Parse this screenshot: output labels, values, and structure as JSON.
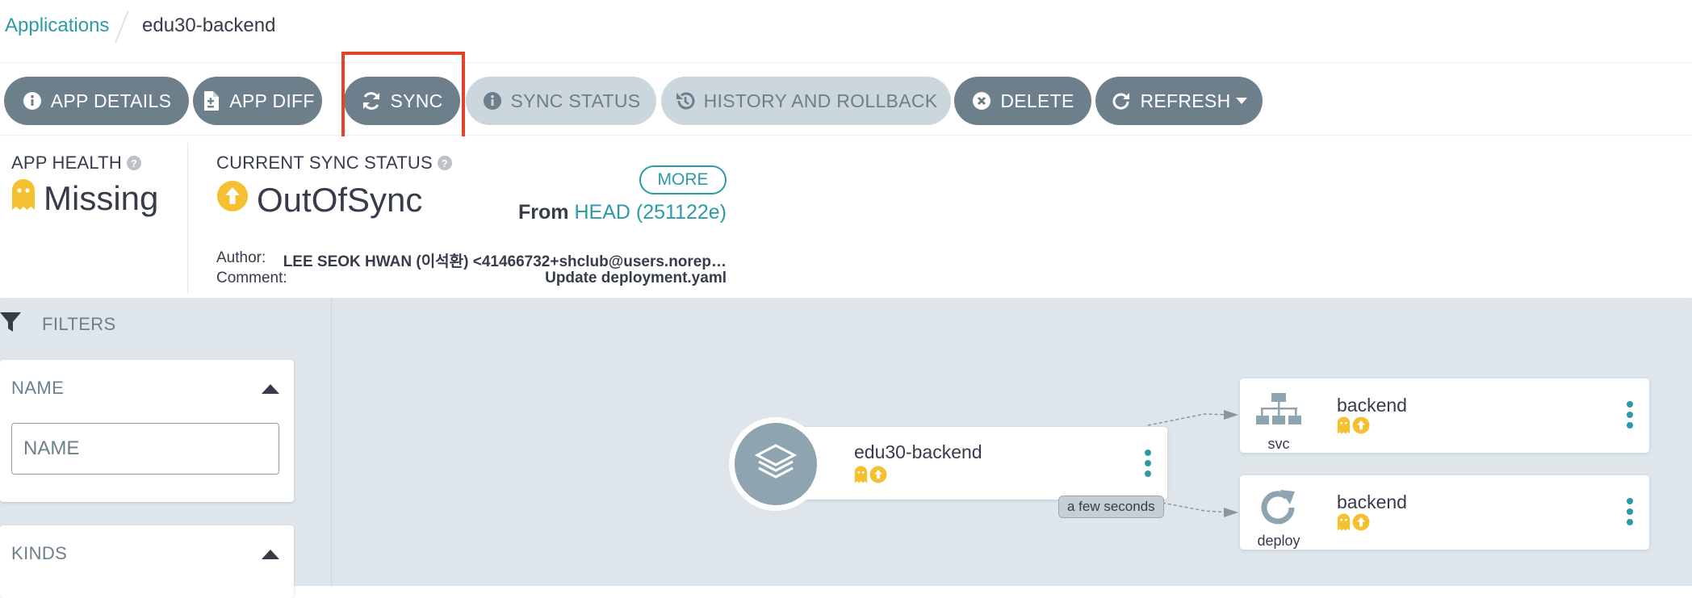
{
  "breadcrumb": {
    "root": "Applications",
    "current": "edu30-backend"
  },
  "toolbar": {
    "app_details": "APP DETAILS",
    "app_diff": "APP DIFF",
    "sync": "SYNC",
    "sync_status": "SYNC STATUS",
    "history": "HISTORY AND ROLLBACK",
    "delete": "DELETE",
    "refresh": "REFRESH"
  },
  "health": {
    "title": "APP HEALTH",
    "value": "Missing"
  },
  "sync_status": {
    "title": "CURRENT SYNC STATUS",
    "value": "OutOfSync",
    "more": "MORE",
    "from_label": "From",
    "revision": "HEAD (251122e)",
    "author_label": "Author:",
    "author": "LEE SEOK HWAN (이석환) <41466732+shclub@users.norep…",
    "comment_label": "Comment:",
    "comment": "Update deployment.yaml"
  },
  "filters": {
    "title": "FILTERS",
    "name_title": "NAME",
    "name_placeholder": "NAME",
    "kinds_title": "KINDS"
  },
  "graph": {
    "app_node": {
      "name": "edu30-backend"
    },
    "edge_label": "a few seconds",
    "resources": [
      {
        "name": "backend",
        "kind": "svc",
        "icon": "sitemap-icon"
      },
      {
        "name": "backend",
        "kind": "deploy",
        "icon": "sync-icon"
      }
    ]
  },
  "colors": {
    "accent": "#2a9ba7",
    "missing": "#f4c030",
    "outofsync": "#f4c030",
    "button": "#6d7f8b",
    "highlight": "#e2432a"
  }
}
